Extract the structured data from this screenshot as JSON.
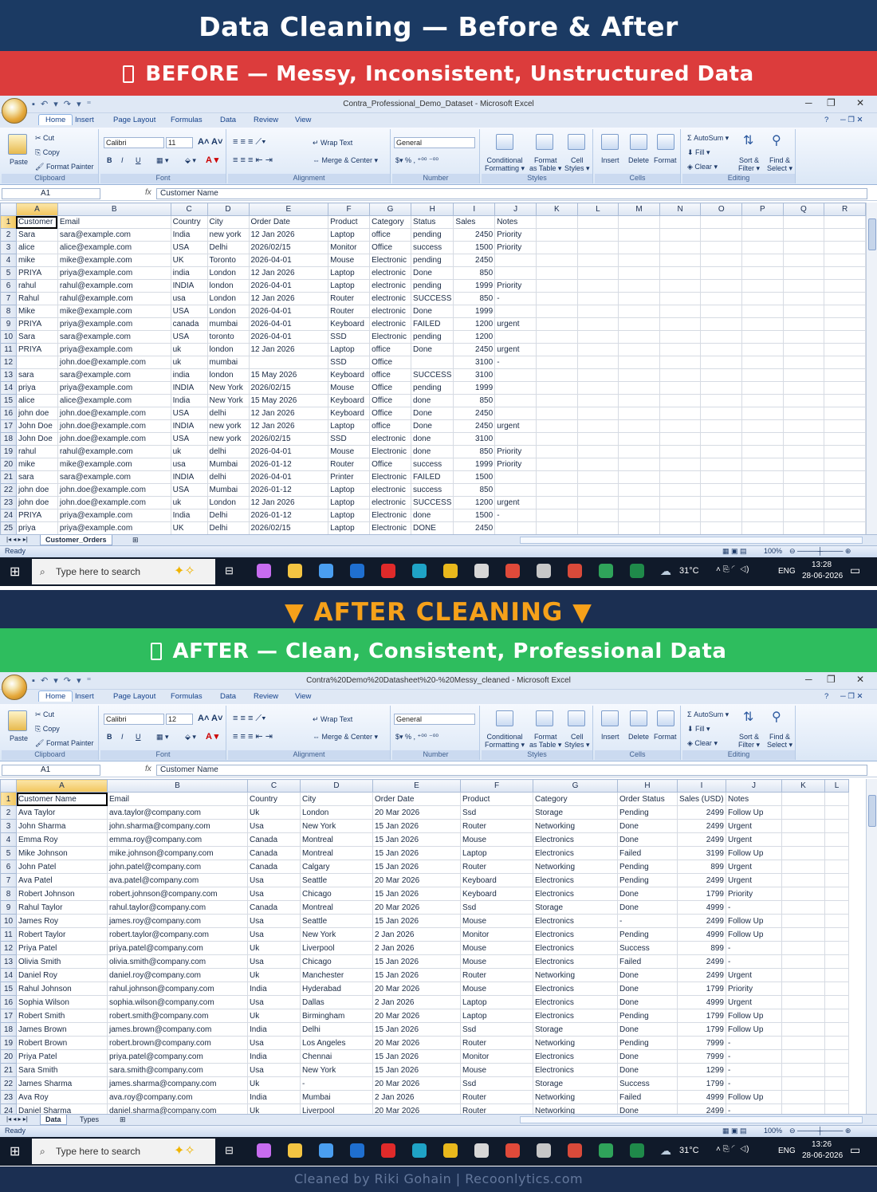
{
  "title": "Data Cleaning — Before & After",
  "before_band": "BEFORE — Messy, Inconsistent, Unstructured Data",
  "mid_band": "▼  AFTER CLEANING  ▼",
  "after_band": "AFTER — Clean, Consistent, Professional Data",
  "footer": "Cleaned by Riki Gohain | Recoonlytics.com",
  "ribbon": {
    "tabs": [
      "Home",
      "Insert",
      "Page Layout",
      "Formulas",
      "Data",
      "Review",
      "View"
    ],
    "paste": "Paste",
    "cut": "Cut",
    "copy": "Copy",
    "format_painter": "Format Painter",
    "clipboard": "Clipboard",
    "font_name": "Calibri",
    "font": "Font",
    "wrap_text": "Wrap Text",
    "merge_center": "Merge & Center",
    "alignment": "Alignment",
    "number_format": "General",
    "number": "Number",
    "conditional": "Conditional",
    "formatting": "Formatting",
    "format_label": "Format",
    "as_table": "as Table",
    "cell": "Cell",
    "styles_lbl": "Styles",
    "styles": "Styles",
    "insert": "Insert",
    "delete": "Delete",
    "format_btn": "Format",
    "cells": "Cells",
    "autosum": "AutoSum",
    "fill": "Fill",
    "clear": "Clear",
    "sort": "Sort &",
    "filter": "Filter",
    "find": "Find &",
    "select": "Select",
    "editing": "Editing"
  },
  "status": {
    "ready": "Ready",
    "zoom": "100%"
  },
  "taskbar": {
    "search": "Type here to search",
    "temp": "31°C",
    "lang": "ENG"
  },
  "before": {
    "window_title": "Contra_Professional_Demo_Dataset - Microsoft Excel",
    "font_size": "11",
    "name_box": "A1",
    "formula": "Customer Name",
    "sheets": [
      "Customer_Orders"
    ],
    "time": "13:28",
    "date": "28-06-2026",
    "columns": [
      "A",
      "B",
      "C",
      "D",
      "E",
      "F",
      "G",
      "H",
      "I",
      "J",
      "K",
      "L",
      "M",
      "N",
      "O",
      "P",
      "Q",
      "R"
    ],
    "rows": [
      [
        "Customer",
        "Email",
        "Country",
        "City",
        "Order Date",
        "Product",
        "Category",
        "Status",
        "Sales",
        "Notes"
      ],
      [
        "Sara",
        "sara@example.com",
        "India",
        "new york",
        "12 Jan 2026",
        "Laptop",
        "office",
        "pending",
        "2450",
        "Priority"
      ],
      [
        " alice",
        "alice@example.com",
        "USA",
        "Delhi",
        "2026/02/15",
        "Monitor",
        "Office",
        "success",
        "1500",
        "Priority"
      ],
      [
        "mike",
        "mike@example.com",
        "UK",
        "Toronto",
        "2026-04-01",
        "Mouse",
        "Electronic",
        "pending",
        "2450",
        ""
      ],
      [
        "PRIYA",
        "priya@example.com",
        "india",
        "London",
        "12 Jan 2026",
        "Laptop",
        "electronic",
        "Done",
        "850",
        ""
      ],
      [
        "rahul",
        "rahul@example.com",
        "INDIA",
        "london",
        "2026-04-01",
        "Laptop",
        "electronic",
        "pending",
        "1999",
        "Priority"
      ],
      [
        "Rahul",
        "rahul@example.com",
        "usa",
        "London",
        "12 Jan 2026",
        "Router",
        "electronic",
        "SUCCESS",
        "850",
        "-"
      ],
      [
        "Mike",
        "mike@example.com",
        "USA",
        "London",
        "2026-04-01",
        "Router",
        "electronic",
        "Done",
        "1999",
        ""
      ],
      [
        "PRIYA",
        "priya@example.com",
        "canada",
        "mumbai",
        "2026-04-01",
        "Keyboard",
        "electronic",
        "FAILED",
        "1200",
        "urgent"
      ],
      [
        "Sara",
        "sara@example.com",
        "USA",
        "toronto",
        "2026-04-01",
        "SSD",
        "Electronic",
        "pending",
        "1200",
        ""
      ],
      [
        "PRIYA",
        "priya@example.com",
        "uk",
        "london",
        "12 Jan 2026",
        "Laptop",
        "office",
        "Done",
        "2450",
        "urgent"
      ],
      [
        "",
        "john.doe@example.com",
        "uk",
        "mumbai",
        "",
        "SSD",
        "Office",
        "",
        "3100",
        "-"
      ],
      [
        "sara",
        "sara@example.com",
        "india",
        "london",
        "15 May 2026",
        "Keyboard",
        "office",
        "SUCCESS",
        "3100",
        ""
      ],
      [
        "priya",
        "priya@example.com",
        "INDIA",
        "New York",
        "2026/02/15",
        "Mouse",
        "Office",
        "pending",
        "1999",
        ""
      ],
      [
        " alice",
        "alice@example.com",
        "India",
        "New York",
        "15 May 2026",
        "Keyboard",
        "Office",
        "done",
        "850",
        ""
      ],
      [
        "john doe",
        "john.doe@example.com",
        "USA",
        "delhi",
        "12 Jan 2026",
        "Keyboard",
        "Office",
        "Done",
        "2450",
        ""
      ],
      [
        "John Doe",
        "john.doe@example.com",
        "INDIA",
        "new york",
        "12 Jan 2026",
        "Laptop",
        "office",
        "Done",
        "2450",
        "urgent"
      ],
      [
        "John Doe",
        "john.doe@example.com",
        "USA",
        "new york",
        "2026/02/15",
        "SSD",
        "electronic",
        "done",
        "3100",
        ""
      ],
      [
        "rahul",
        "rahul@example.com",
        "uk",
        "delhi",
        "2026-04-01",
        "Mouse",
        "Electronic",
        "done",
        "850",
        "Priority"
      ],
      [
        "mike",
        "mike@example.com",
        "usa",
        "Mumbai",
        "2026-01-12",
        "Router",
        "Office",
        "success",
        "1999",
        "Priority"
      ],
      [
        "sara",
        "sara@example.com",
        "INDIA",
        "delhi",
        "2026-04-01",
        "Printer",
        "Electronic",
        "FAILED",
        "1500",
        ""
      ],
      [
        "john doe",
        "john.doe@example.com",
        "USA",
        "Mumbai",
        "2026-01-12",
        "Laptop",
        "electronic",
        "success",
        "850",
        ""
      ],
      [
        "john doe",
        "john.doe@example.com",
        "uk",
        "London",
        "12 Jan 2026",
        "Laptop",
        "electronic",
        "SUCCESS",
        "1200",
        "urgent"
      ],
      [
        "PRIYA",
        "priya@example.com",
        "India",
        "Delhi",
        "2026-01-12",
        "Laptop",
        "Electronic",
        "done",
        "1500",
        "-"
      ],
      [
        "priya",
        "priya@example.com",
        "UK",
        "Delhi",
        "2026/02/15",
        "Laptop",
        "Electronic",
        "DONE",
        "2450",
        ""
      ]
    ]
  },
  "after": {
    "window_title": "Contra%20Demo%20Datasheet%20-%20Messy_cleaned - Microsoft Excel",
    "font_size": "12",
    "name_box": "A1",
    "formula": "Customer Name",
    "sheets": [
      "Data",
      "Types"
    ],
    "time": "13:26",
    "date": "28-06-2026",
    "columns": [
      "A",
      "B",
      "C",
      "D",
      "E",
      "F",
      "G",
      "H",
      "I",
      "J",
      "K",
      "L"
    ],
    "rows": [
      [
        "Customer Name",
        "Email",
        "Country",
        "City",
        "Order Date",
        "Product",
        "Category",
        "Order Status",
        "Sales (USD)",
        "Notes"
      ],
      [
        "Ava Taylor",
        "ava.taylor@company.com",
        "Uk",
        "London",
        "20 Mar 2026",
        "Ssd",
        "Storage",
        "Pending",
        "2499",
        "Follow Up"
      ],
      [
        "John Sharma",
        "john.sharma@company.com",
        "Usa",
        "New York",
        "15 Jan 2026",
        "Router",
        "Networking",
        "Done",
        "2499",
        "Urgent"
      ],
      [
        "Emma Roy",
        "emma.roy@company.com",
        "Canada",
        "Montreal",
        "15 Jan 2026",
        "Mouse",
        "Electronics",
        "Done",
        "2499",
        "Urgent"
      ],
      [
        "Mike Johnson",
        "mike.johnson@company.com",
        "Canada",
        "Montreal",
        "15 Jan 2026",
        "Laptop",
        "Electronics",
        "Failed",
        "3199",
        "Follow Up"
      ],
      [
        "John Patel",
        "john.patel@company.com",
        "Canada",
        "Calgary",
        "15 Jan 2026",
        "Router",
        "Networking",
        "Pending",
        "899",
        "Urgent"
      ],
      [
        "Ava Patel",
        "ava.patel@company.com",
        "Usa",
        "Seattle",
        "20 Mar 2026",
        "Keyboard",
        "Electronics",
        "Pending",
        "2499",
        "Urgent"
      ],
      [
        "Robert Johnson",
        "robert.johnson@company.com",
        "Usa",
        "Chicago",
        "15 Jan 2026",
        "Keyboard",
        "Electronics",
        "Done",
        "1799",
        "Priority"
      ],
      [
        "Rahul Taylor",
        "rahul.taylor@company.com",
        "Canada",
        "Montreal",
        "20 Mar 2026",
        "Ssd",
        "Storage",
        "Done",
        "4999",
        "-"
      ],
      [
        "James Roy",
        "james.roy@company.com",
        "Usa",
        "Seattle",
        "15 Jan 2026",
        "Mouse",
        "Electronics",
        "-",
        "2499",
        "Follow Up"
      ],
      [
        "Robert Taylor",
        "robert.taylor@company.com",
        "Usa",
        "New York",
        "2 Jan 2026",
        "Monitor",
        "Electronics",
        "Pending",
        "4999",
        "Follow Up"
      ],
      [
        "Priya Patel",
        "priya.patel@company.com",
        "Uk",
        "Liverpool",
        "2 Jan 2026",
        "Mouse",
        "Electronics",
        "Success",
        "899",
        "-"
      ],
      [
        "Olivia Smith",
        "olivia.smith@company.com",
        "Usa",
        "Chicago",
        "15 Jan 2026",
        "Mouse",
        "Electronics",
        "Failed",
        "2499",
        "-"
      ],
      [
        "Daniel Roy",
        "daniel.roy@company.com",
        "Uk",
        "Manchester",
        "15 Jan 2026",
        "Router",
        "Networking",
        "Done",
        "2499",
        "Urgent"
      ],
      [
        "Rahul Johnson",
        "rahul.johnson@company.com",
        "India",
        "Hyderabad",
        "20 Mar 2026",
        "Mouse",
        "Electronics",
        "Done",
        "1799",
        "Priority"
      ],
      [
        "Sophia Wilson",
        "sophia.wilson@company.com",
        "Usa",
        "Dallas",
        "2 Jan 2026",
        "Laptop",
        "Electronics",
        "Done",
        "4999",
        "Urgent"
      ],
      [
        "Robert Smith",
        "robert.smith@company.com",
        "Uk",
        "Birmingham",
        "20 Mar 2026",
        "Laptop",
        "Electronics",
        "Pending",
        "1799",
        "Follow Up"
      ],
      [
        "James Brown",
        "james.brown@company.com",
        "India",
        "Delhi",
        "15 Jan 2026",
        "Ssd",
        "Storage",
        "Done",
        "1799",
        "Follow Up"
      ],
      [
        "Robert Brown",
        "robert.brown@company.com",
        "Usa",
        "Los Angeles",
        "20 Mar 2026",
        "Router",
        "Networking",
        "Pending",
        "7999",
        "-"
      ],
      [
        "Priya Patel",
        "priya.patel@company.com",
        "India",
        "Chennai",
        "15 Jan 2026",
        "Monitor",
        "Electronics",
        "Done",
        "7999",
        "-"
      ],
      [
        "Sara Smith",
        "sara.smith@company.com",
        "Usa",
        "New York",
        "15 Jan 2026",
        "Mouse",
        "Electronics",
        "Done",
        "1299",
        "-"
      ],
      [
        "James Sharma",
        "james.sharma@company.com",
        "Uk",
        "-",
        "20 Mar 2026",
        "Ssd",
        "Storage",
        "Success",
        "1799",
        "-"
      ],
      [
        "Ava Roy",
        "ava.roy@company.com",
        "India",
        "Mumbai",
        "2 Jan 2026",
        "Router",
        "Networking",
        "Failed",
        "4999",
        "Follow Up"
      ],
      [
        "Daniel Sharma",
        "daniel.sharma@company.com",
        "Uk",
        "Liverpool",
        "20 Mar 2026",
        "Router",
        "Networking",
        "Done",
        "2499",
        "-"
      ]
    ]
  }
}
